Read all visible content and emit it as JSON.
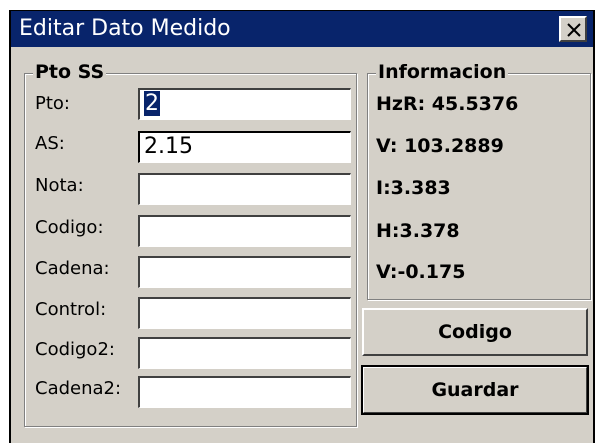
{
  "window": {
    "title": "Editar Dato Medido",
    "close_glyph": "×"
  },
  "left_group": {
    "title": "Pto SS",
    "fields": [
      {
        "label": "Pto:",
        "value": "2",
        "selected": true
      },
      {
        "label": "AS:",
        "value": "2.15"
      },
      {
        "label": "Nota:",
        "value": ""
      },
      {
        "label": "Codigo:",
        "value": ""
      },
      {
        "label": "Cadena:",
        "value": ""
      },
      {
        "label": "Control:",
        "value": ""
      },
      {
        "label": "Codigo2:",
        "value": ""
      },
      {
        "label": "Cadena2:",
        "value": ""
      }
    ]
  },
  "info_group": {
    "title": "Informacion",
    "lines": [
      "HzR: 45.5376",
      "V: 103.2889",
      "I:3.383",
      "H:3.378",
      "V:-0.175"
    ]
  },
  "buttons": {
    "codigo": "Codigo",
    "guardar": "Guardar"
  },
  "colors": {
    "titlebar": "#08246b",
    "face": "#d4d0c8",
    "selection": "#08246b"
  },
  "icons": {
    "close": "close-icon"
  }
}
